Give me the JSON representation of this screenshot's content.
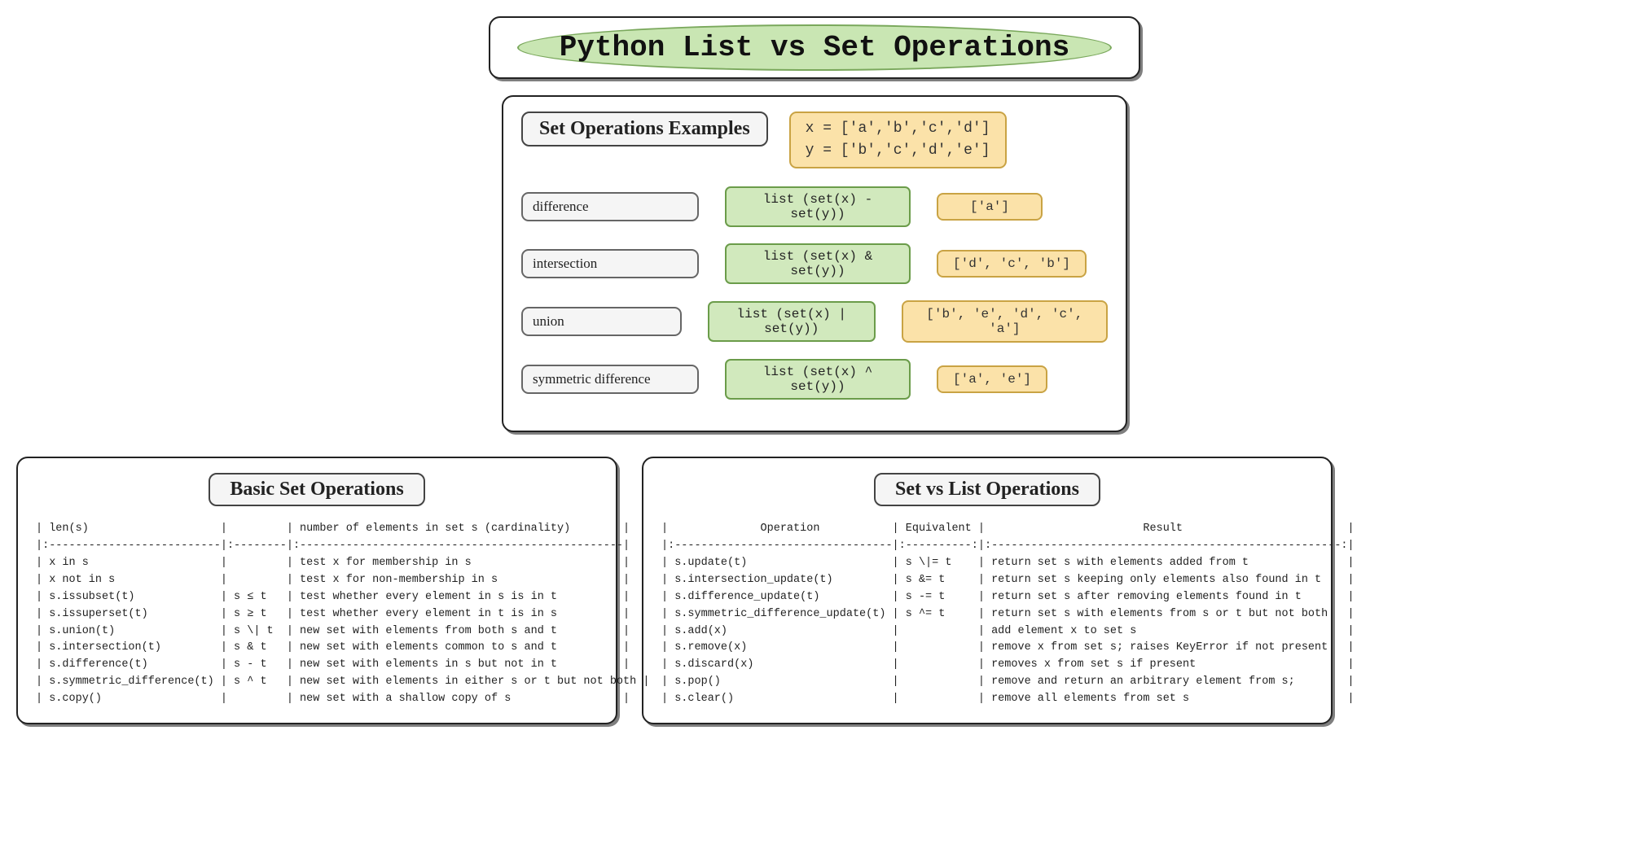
{
  "title": "Python List vs Set Operations",
  "examples": {
    "heading": "Set Operations Examples",
    "defs_x": "x = ['a','b','c','d']",
    "defs_y": "y = ['b','c','d','e']",
    "rows": [
      {
        "label": "difference",
        "code": "list (set(x) - set(y))",
        "result": "['a']"
      },
      {
        "label": "intersection",
        "code": "list (set(x) & set(y))",
        "result": "['d', 'c', 'b']"
      },
      {
        "label": "union",
        "code": "list (set(x) | set(y))",
        "result": "['b', 'e', 'd', 'c', 'a']"
      },
      {
        "label": "symmetric difference",
        "code": "list (set(x) ^ set(y))",
        "result": "['a', 'e']"
      }
    ]
  },
  "basic_ops": {
    "heading": "Basic Set Operations",
    "table": "| len(s)                    |         | number of elements in set s (cardinality)        |\n|:--------------------------|:--------|:-------------------------------------------------|\n| x in s                    |         | test x for membership in s                       |\n| x not in s                |         | test x for non-membership in s                   |\n| s.issubset(t)             | s ≤ t   | test whether every element in s is in t          |\n| s.issuperset(t)           | s ≥ t   | test whether every element in t is in s          |\n| s.union(t)                | s \\| t  | new set with elements from both s and t          |\n| s.intersection(t)         | s & t   | new set with elements common to s and t          |\n| s.difference(t)           | s - t   | new set with elements in s but not in t          |\n| s.symmetric_difference(t) | s ^ t   | new set with elements in either s or t but not both |\n| s.copy()                  |         | new set with a shallow copy of s                 |"
  },
  "set_vs_list": {
    "heading": "Set vs List Operations",
    "table": "|              Operation           | Equivalent |                        Result                         |\n|:---------------------------------|:----------:|:-----------------------------------------------------:|\n| s.update(t)                      | s \\|= t    | return set s with elements added from t               |\n| s.intersection_update(t)         | s &= t     | return set s keeping only elements also found in t    |\n| s.difference_update(t)           | s -= t     | return set s after removing elements found in t       |\n| s.symmetric_difference_update(t) | s ^= t     | return set s with elements from s or t but not both   |\n| s.add(x)                         |            | add element x to set s                                |\n| s.remove(x)                      |            | remove x from set s; raises KeyError if not present   |\n| s.discard(x)                     |            | removes x from set s if present                       |\n| s.pop()                          |            | remove and return an arbitrary element from s;        |\n| s.clear()                        |            | remove all elements from set s                        |"
  }
}
